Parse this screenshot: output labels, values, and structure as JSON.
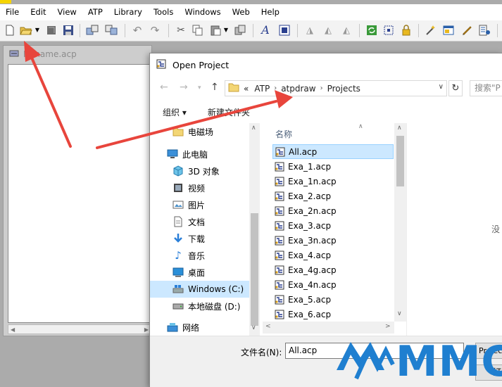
{
  "menubar": {
    "items": [
      "File",
      "Edit",
      "View",
      "ATP",
      "Library",
      "Tools",
      "Windows",
      "Web",
      "Help"
    ]
  },
  "child_window": {
    "title": "Noname.acp"
  },
  "dialog": {
    "title": "Open Project",
    "breadcrumb": [
      "«",
      "ATP",
      "atpdraw",
      "Projects"
    ],
    "search_placeholder": "搜索\"P",
    "organize_label": "组织 ▾",
    "new_folder_label": "新建文件夹",
    "nav_items": [
      {
        "label": "电磁场",
        "icon": "folder-icon"
      },
      {
        "label": "此电脑",
        "icon": "computer-icon"
      },
      {
        "label": "3D 对象",
        "icon": "cube-icon"
      },
      {
        "label": "视频",
        "icon": "video-icon"
      },
      {
        "label": "图片",
        "icon": "picture-icon"
      },
      {
        "label": "文档",
        "icon": "document-icon"
      },
      {
        "label": "下载",
        "icon": "download-icon"
      },
      {
        "label": "音乐",
        "icon": "music-icon"
      },
      {
        "label": "桌面",
        "icon": "desktop-icon"
      },
      {
        "label": "Windows (C:)",
        "icon": "windows-drive-icon"
      },
      {
        "label": "本地磁盘 (D:)",
        "icon": "drive-icon"
      },
      {
        "label": "网络",
        "icon": "network-icon"
      }
    ],
    "column_header": "名称",
    "files": [
      "All.acp",
      "Exa_1.acp",
      "Exa_1n.acp",
      "Exa_2.acp",
      "Exa_2n.acp",
      "Exa_3.acp",
      "Exa_3n.acp",
      "Exa_4.acp",
      "Exa_4g.acp",
      "Exa_4n.acp",
      "Exa_5.acp",
      "Exa_6.acp"
    ],
    "selected_file": "All.acp",
    "preview_text": "没",
    "filename_label": "文件名(N):",
    "filename_value": "All.acp",
    "type_button_label": "Project",
    "open_button_label": "打开"
  },
  "watermark": {
    "text": "MMC"
  },
  "colors": {
    "arrow": "#e8453c",
    "watermark_blue": "#1f7fd0",
    "selection": "#cce8ff"
  }
}
